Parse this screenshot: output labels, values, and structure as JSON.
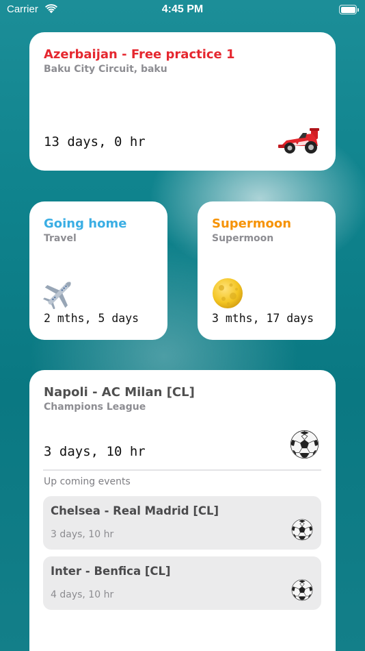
{
  "status_bar": {
    "carrier": "Carrier",
    "time": "4:45 PM"
  },
  "cards": {
    "baku": {
      "title": "Azerbaijan - Free practice 1",
      "subtitle": "Baku City Circuit, baku",
      "countdown": "13 days, 0 hr",
      "icon": "race-car-icon",
      "title_color": "#e5272f"
    },
    "travel": {
      "title": "Going home",
      "subtitle": "Travel",
      "countdown": "2 mths, 5 days",
      "icon": "airplane-icon",
      "title_color": "#3aaee4"
    },
    "moon": {
      "title": "Supermoon",
      "subtitle": "Supermoon",
      "countdown": "3 mths, 17 days",
      "icon": "full-moon-icon",
      "title_color": "#f69307"
    },
    "napoli": {
      "title": "Napoli - AC Milan [CL]",
      "subtitle": "Champions League",
      "countdown": "3 days, 10 hr",
      "icon": "soccer-ball-icon",
      "upcoming_label": "Up coming events",
      "upcoming": [
        {
          "title": "Chelsea - Real Madrid [CL]",
          "time": "3 days, 10 hr",
          "icon": "soccer-ball-icon"
        },
        {
          "title": "Inter - Benfica [CL]",
          "time": "4 days, 10 hr",
          "icon": "soccer-ball-icon"
        }
      ]
    }
  }
}
